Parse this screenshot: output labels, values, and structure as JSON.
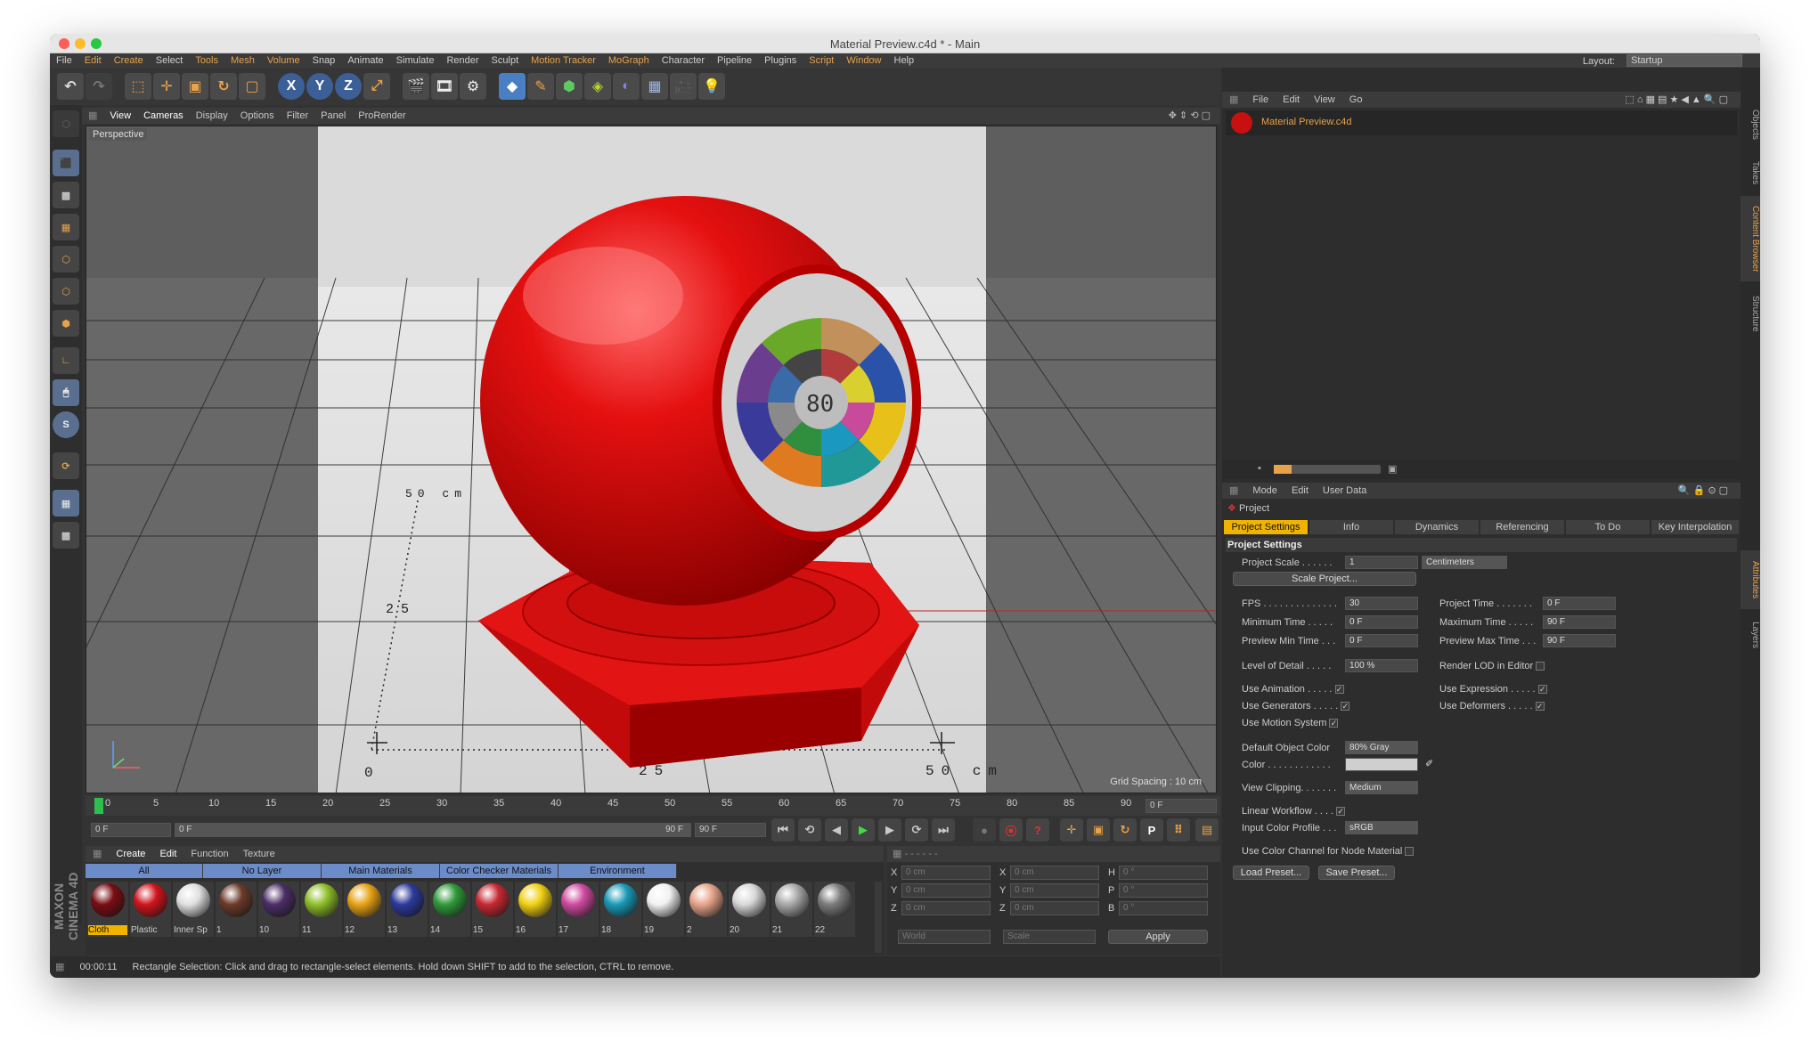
{
  "window": {
    "title": "Material Preview.c4d * - Main"
  },
  "menu": [
    "File",
    "Edit",
    "Create",
    "Select",
    "Tools",
    "Mesh",
    "Volume",
    "Snap",
    "Animate",
    "Simulate",
    "Render",
    "Sculpt",
    "Motion Tracker",
    "MoGraph",
    "Character",
    "Pipeline",
    "Plugins",
    "Script",
    "Window",
    "Help"
  ],
  "layout": {
    "label": "Layout:",
    "value": "Startup"
  },
  "viewport": {
    "menu": [
      "View",
      "Cameras",
      "Display",
      "Options",
      "Filter",
      "Panel",
      "ProRender"
    ],
    "label": "Perspective",
    "grid_spacing": "Grid Spacing : 10 cm",
    "ruler": {
      "a": "0",
      "b": "25",
      "c": "50 cm",
      "side_a": "25",
      "side_b": "50 cm"
    },
    "chart_text": "80"
  },
  "timeline": {
    "ticks": [
      "0",
      "5",
      "10",
      "15",
      "20",
      "25",
      "30",
      "35",
      "40",
      "45",
      "50",
      "55",
      "60",
      "65",
      "70",
      "75",
      "80",
      "85",
      "90"
    ],
    "end_frame": "0 F"
  },
  "transport": {
    "start": "0 F",
    "range_start": "0 F",
    "range_end": "90 F",
    "end": "90 F"
  },
  "materials": {
    "menu": [
      "Create",
      "Edit",
      "Function",
      "Texture"
    ],
    "tabs": [
      "All",
      "No Layer",
      "Main Materials",
      "Color Checker Materials",
      "Environment"
    ],
    "items": [
      {
        "label": "Cloth",
        "color": "#7a0d14"
      },
      {
        "label": "Plastic",
        "color": "#d0141c"
      },
      {
        "label": "Inner Sp",
        "color": "#e0e0e0"
      },
      {
        "label": "1",
        "color": "#6b3b2a"
      },
      {
        "label": "10",
        "color": "#4b2e66"
      },
      {
        "label": "11",
        "color": "#8fbf2a"
      },
      {
        "label": "12",
        "color": "#e8a317"
      },
      {
        "label": "13",
        "color": "#2c3a9c"
      },
      {
        "label": "14",
        "color": "#2f9a3a"
      },
      {
        "label": "15",
        "color": "#c72a32"
      },
      {
        "label": "16",
        "color": "#f0d012"
      },
      {
        "label": "17",
        "color": "#d04aa0"
      },
      {
        "label": "18",
        "color": "#1a9ab8"
      },
      {
        "label": "19",
        "color": "#f2f2f2"
      },
      {
        "label": "2",
        "color": "#e7a48a"
      },
      {
        "label": "20",
        "color": "#d8d8d8"
      },
      {
        "label": "21",
        "color": "#a8a8a8"
      },
      {
        "label": "22",
        "color": "#7c7c7c"
      }
    ]
  },
  "coords": {
    "rows": [
      {
        "a": "X",
        "av": "0 cm",
        "b": "X",
        "bv": "0 cm",
        "c": "H",
        "cv": "0 °"
      },
      {
        "a": "Y",
        "av": "0 cm",
        "b": "Y",
        "bv": "0 cm",
        "c": "P",
        "cv": "0 °"
      },
      {
        "a": "Z",
        "av": "0 cm",
        "b": "Z",
        "bv": "0 cm",
        "c": "B",
        "cv": "0 °"
      }
    ],
    "world": "World",
    "scale": "Scale",
    "apply": "Apply"
  },
  "status": {
    "time": "00:00:11",
    "text": "Rectangle Selection: Click and drag to rectangle-select elements. Hold down SHIFT to add to the selection, CTRL to remove."
  },
  "content_browser": {
    "menu": [
      "File",
      "Edit",
      "View",
      "Go"
    ],
    "file": "Material Preview.c4d"
  },
  "side_tabs": [
    "Objects",
    "Takes",
    "Content Browser",
    "Structure",
    "Attributes",
    "Layers"
  ],
  "attributes": {
    "menu": [
      "Mode",
      "Edit",
      "User Data"
    ],
    "object": "Project",
    "tabs": [
      "Project Settings",
      "Info",
      "Dynamics",
      "Referencing",
      "To Do",
      "Key Interpolation"
    ],
    "section": "Project Settings",
    "scale_label": "Project Scale . . . . . .",
    "scale_value": "1",
    "scale_unit": "Centimeters",
    "scale_button": "Scale Project...",
    "fps_label": "FPS . . . . . . . . . . . . . .",
    "fps": "30",
    "ptime_label": "Project Time . . . . . . .",
    "ptime": "0 F",
    "mint_label": "Minimum Time . . . . .",
    "mint": "0 F",
    "maxt_label": "Maximum Time . . . . .",
    "maxt": "90 F",
    "pmin_label": "Preview Min Time . . .",
    "pmin": "0 F",
    "pmax_label": "Preview Max Time . . .",
    "pmax": "90 F",
    "lod_label": "Level of Detail . . . . .",
    "lod": "100 %",
    "rlod_label": "Render LOD in Editor",
    "uanim": "Use Animation . . . . .",
    "uexpr": "Use Expression . . . . .",
    "ugen": "Use Generators . . . . .",
    "udef": "Use Deformers . . . . .",
    "umot": "Use Motion System",
    "doc_label": "Default Object Color",
    "doc": "80% Gray",
    "color_label": "Color . . . . . . . . . . . .",
    "vclip_label": "View Clipping. . . . . . .",
    "vclip": "Medium",
    "lw_label": "Linear Workflow . . . .",
    "icp_label": "Input Color Profile . . .",
    "icp": "sRGB",
    "ucc_label": "Use Color Channel for Node Material",
    "load": "Load Preset...",
    "save": "Save Preset..."
  },
  "colors": {
    "accent": "#e8a24a",
    "tab_blue": "#6b8cc8",
    "selected_tab": "#f0b400",
    "red": "#d60a0a"
  }
}
